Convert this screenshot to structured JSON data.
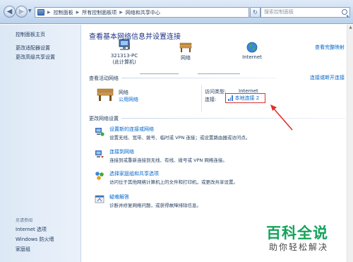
{
  "address_bar": {
    "breadcrumbs": [
      "控制面板",
      "所有控制面板项",
      "网络和共享中心"
    ],
    "search_placeholder": "搜索控制面板"
  },
  "left_pane": {
    "links": [
      "控制面板主页",
      "更改适配器设置",
      "更改高级共享设置"
    ],
    "see_also_title": "另请参阅",
    "see_also_links": [
      "Internet 选项",
      "Windows 防火墙",
      "家庭组"
    ]
  },
  "main": {
    "title": "查看基本网络信息并设置连接",
    "full_map_link": "查看完整映射",
    "network_map": {
      "computer_name": "321313-PC",
      "computer_sub": "(此计算机)",
      "network_label": "网络",
      "internet_label": "Internet"
    },
    "active_networks": {
      "header": "查看活动网络",
      "connect_link": "连接或断开连接",
      "network_name": "网络",
      "network_type": "公用网络",
      "access_type_label": "访问类型:",
      "access_type_value": "Internet",
      "connections_label": "连接:",
      "connection_value": "本地连接 2"
    },
    "change_settings": {
      "header": "更改网络设置",
      "tasks": [
        {
          "title": "设置新的连接或网络",
          "desc": "设置无线、宽带、拨号、临时或 VPN 连接；或设置路由器或访问点。"
        },
        {
          "title": "连接到网络",
          "desc": "连接到或重新连接到无线、有线、拨号或 VPN 网络连接。"
        },
        {
          "title": "选择家庭组和共享选项",
          "desc": "访问位于其他网络计算机上的文件和打印机，或更改共享设置。"
        },
        {
          "title": "疑难解答",
          "desc": "诊断并修复网络问题，或获得故障排除信息。"
        }
      ]
    }
  },
  "watermark": {
    "main": "百科全说",
    "sub": "助你轻松解决"
  },
  "colors": {
    "link": "#0066cc",
    "title": "#1e3287",
    "highlight_box": "#e0302a",
    "watermark_green": "#14a35a"
  }
}
